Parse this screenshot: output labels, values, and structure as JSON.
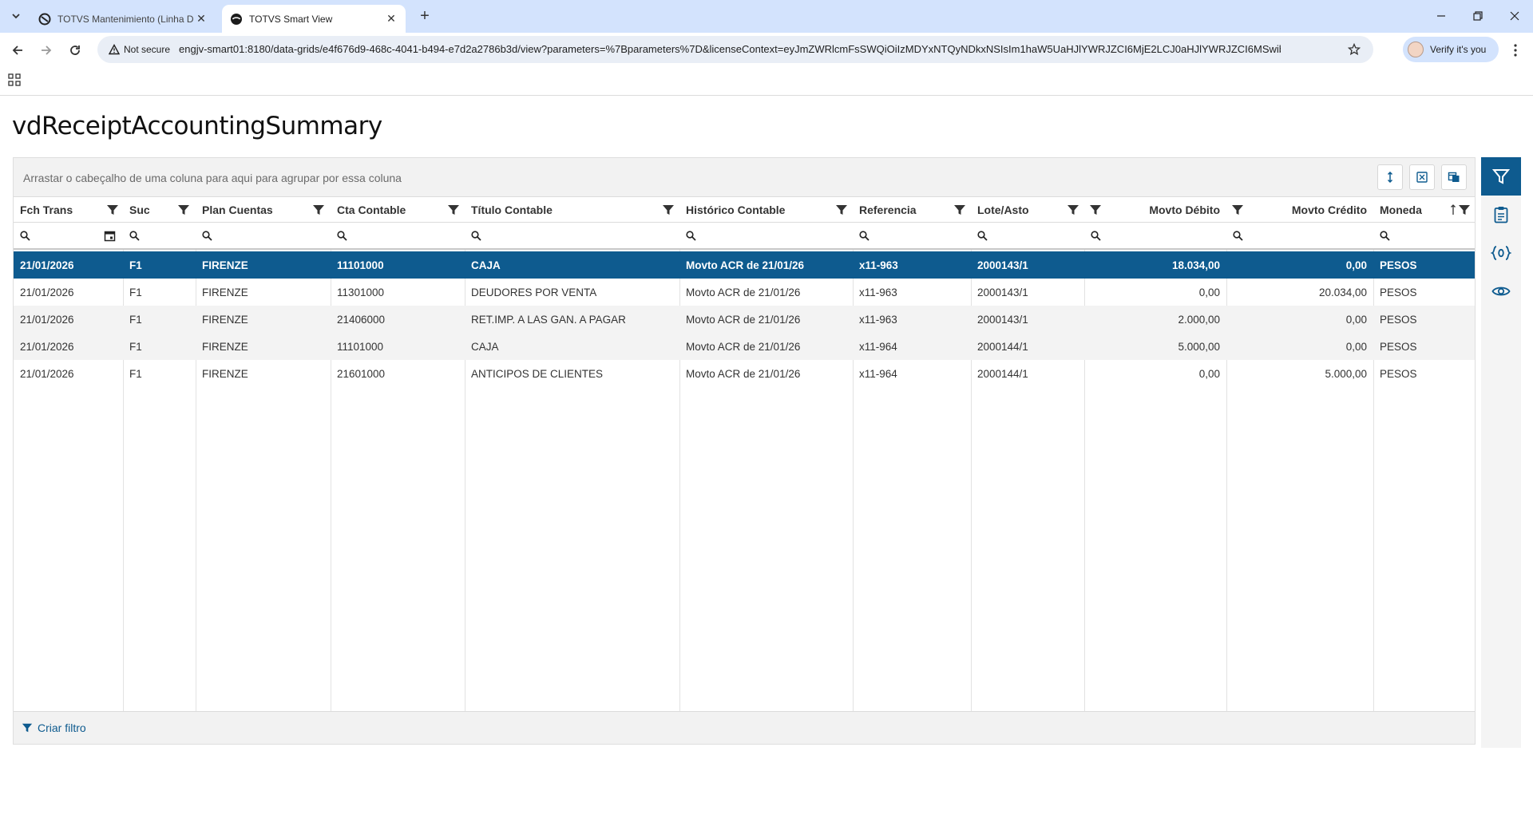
{
  "browser": {
    "tabs": [
      {
        "title": "TOTVS Mantenimiento (Linha D",
        "active": false
      },
      {
        "title": "TOTVS Smart View",
        "active": true
      }
    ],
    "security_label": "Not secure",
    "url": "engjv-smart01:8180/data-grids/e4f676d9-468c-4041-b494-e7d2a2786b3d/view?parameters=%7Bparameters%7D&licenseContext=eyJmZWRlcmFsSWQiOiIzMDYxNTQyNDkxNSIsIm1haW5UaHJlYWRJZCI6MjE2LCJ0aHJlYWRJZCI6MSwibW9...",
    "profile_label": "Verify it's you"
  },
  "page": {
    "title": "vdReceiptAccountingSummary"
  },
  "grid": {
    "group_hint": "Arrastar o cabeçalho de uma coluna para aqui para agrupar por essa coluna",
    "columns": [
      {
        "label": "Fch Trans",
        "align": "left"
      },
      {
        "label": "Suc",
        "align": "left"
      },
      {
        "label": "Plan Cuentas",
        "align": "left"
      },
      {
        "label": "Cta Contable",
        "align": "left"
      },
      {
        "label": "Título Contable",
        "align": "left"
      },
      {
        "label": "Histórico Contable",
        "align": "left"
      },
      {
        "label": "Referencia",
        "align": "left"
      },
      {
        "label": "Lote/Asto",
        "align": "left"
      },
      {
        "label": "Movto Débito",
        "align": "right"
      },
      {
        "label": "Movto Crédito",
        "align": "right"
      },
      {
        "label": "Moneda",
        "align": "left"
      }
    ],
    "rows": [
      [
        "21/01/2026",
        "F1",
        "FIRENZE",
        "11101000",
        "CAJA",
        "Movto ACR de 21/01/26",
        "x11-963",
        "2000143/1",
        "18.034,00",
        "0,00",
        "PESOS"
      ],
      [
        "21/01/2026",
        "F1",
        "FIRENZE",
        "11301000",
        "DEUDORES POR VENTA",
        "Movto ACR de 21/01/26",
        "x11-963",
        "2000143/1",
        "0,00",
        "20.034,00",
        "PESOS"
      ],
      [
        "21/01/2026",
        "F1",
        "FIRENZE",
        "21406000",
        "RET.IMP. A LAS GAN. A PAGAR",
        "Movto ACR de 21/01/26",
        "x11-963",
        "2000143/1",
        "2.000,00",
        "0,00",
        "PESOS"
      ],
      [
        "21/01/2026",
        "F1",
        "FIRENZE",
        "11101000",
        "CAJA",
        "Movto ACR de 21/01/26",
        "x11-964",
        "2000144/1",
        "5.000,00",
        "0,00",
        "PESOS"
      ],
      [
        "21/01/2026",
        "F1",
        "FIRENZE",
        "21601000",
        "ANTICIPOS DE CLIENTES",
        "Movto ACR de 21/01/26",
        "x11-964",
        "2000144/1",
        "0,00",
        "5.000,00",
        "PESOS"
      ]
    ],
    "selected_row": 0,
    "footer_label": "Criar filtro"
  },
  "colors": {
    "accent": "#0e5b8f",
    "tabstrip": "#d3e3fd",
    "group_panel": "#f2f2f2",
    "row_alt": "#f3f3f3"
  },
  "icons": {
    "rail": [
      "filter-icon",
      "clipboard-icon",
      "variables-icon",
      "eye-icon"
    ],
    "grid_toolbar": [
      "row-height-icon",
      "export-excel-icon",
      "column-chooser-icon"
    ]
  }
}
